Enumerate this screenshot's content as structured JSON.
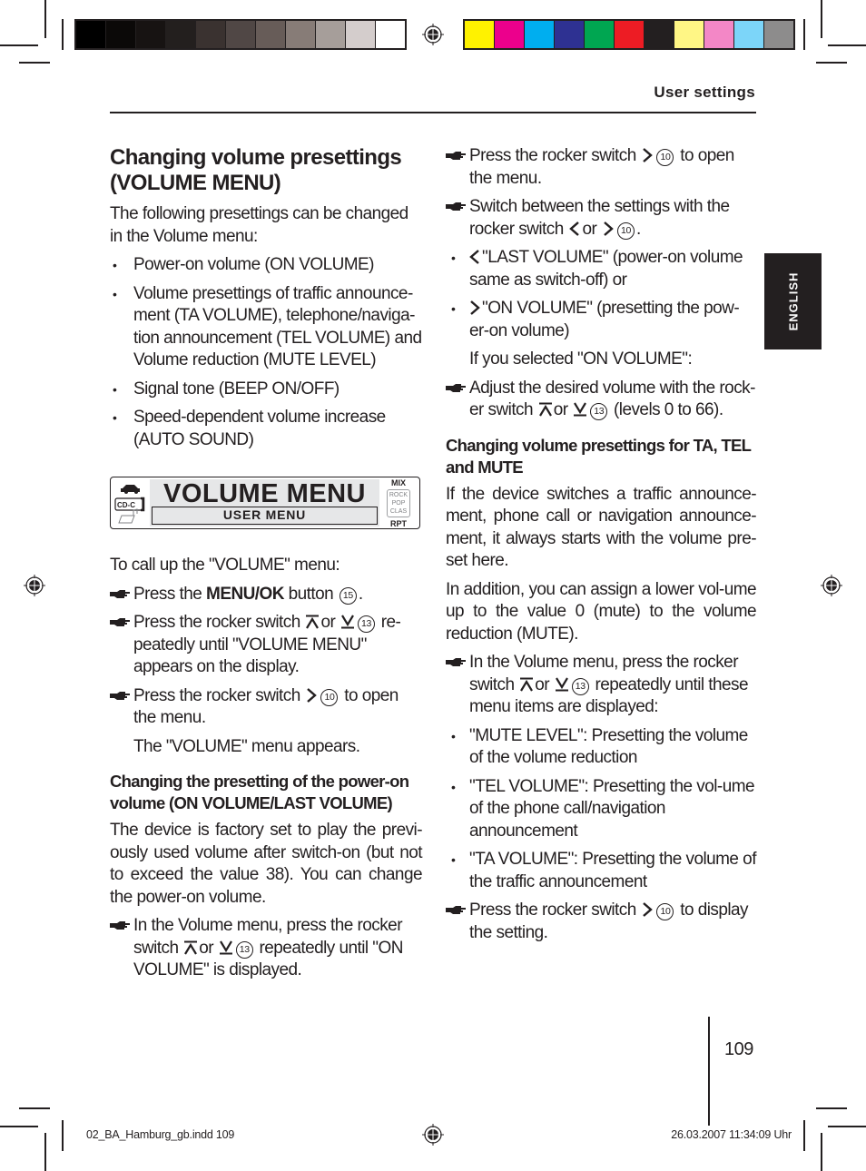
{
  "print_marks": {
    "grey_swatches": [
      "#000000",
      "#0b0908",
      "#171312",
      "#231f1e",
      "#3a3230",
      "#504745",
      "#675c58",
      "#877c77",
      "#a69e9a",
      "#d4cdcc",
      "#ffffff"
    ],
    "color_swatches": [
      "#fff200",
      "#ec008c",
      "#00aeef",
      "#2e3192",
      "#00a651",
      "#ed1c24",
      "#231f20",
      "#fff685",
      "#f387c6",
      "#7cd5f9",
      "#8d8c8c"
    ]
  },
  "header": {
    "section_title": "User settings"
  },
  "language_tab": "ENGLISH",
  "left_column": {
    "title": "Changing volume presettings (VOLUME MENU)",
    "intro": "The following presettings can be changed in the Volume menu:",
    "bullets": [
      "Power-on volume (ON VOLUME)",
      "Volume presettings of traffic announce-ment (TA VOLUME), telephone/naviga-tion announcement (TEL VOLUME) and Volume reduction (MUTE LEVEL)",
      "Signal tone (BEEP ON/OFF)",
      "Speed-dependent volume increase (AUTO SOUND)"
    ],
    "display": {
      "main_text": "VOLUME MENU",
      "sub_text": "USER MENU",
      "source_label": "CD-C",
      "mix_label": "MIX",
      "eq_options": [
        "ROCK",
        "POP",
        "CLAS"
      ],
      "rpt_label": "RPT"
    },
    "call_up_intro": "To call up the \"VOLUME\" menu:",
    "steps": [
      {
        "pre": "Press the ",
        "bold": "MENU/OK",
        "post": " button",
        "ref": "15",
        "tail": "."
      },
      {
        "pre": "Press the rocker switch",
        "sym1": "up",
        "mid": "or",
        "sym2": "down",
        "ref": "13",
        "post": "re-peatedly until \"VOLUME MENU\" appears on the display."
      },
      {
        "pre": "Press the rocker switch",
        "sym1": "right",
        "ref": "10",
        "post": "to open the menu."
      }
    ],
    "step_result": "The \"VOLUME\" menu appears.",
    "subheading": "Changing the presetting of the power-on volume (ON VOLUME/LAST VOLUME)",
    "paragraph": "The device is factory set to play the previ-ously used volume after switch-on (but not to exceed the value 38). You can change the power-on volume.",
    "final_step": {
      "pre": "In the Volume menu, press the rocker switch",
      "mid": "or",
      "ref": "13",
      "post": "repeatedly until \"ON VOLUME\" is displayed."
    }
  },
  "right_column": {
    "step1": {
      "pre": "Press the rocker switch",
      "ref": "10",
      "post": "to open the menu."
    },
    "step2": {
      "pre": "Switch between the settings with the rocker switch",
      "mid": "or",
      "ref": "10",
      "tail": "."
    },
    "options": [
      {
        "symbol": "left",
        "text": "\"LAST VOLUME\" (power-on volume same as switch-off) or"
      },
      {
        "symbol": "right",
        "text": "\"ON VOLUME\" (presetting the pow-er-on volume)"
      }
    ],
    "if_selected": "If you selected \"ON VOLUME\":",
    "step3": {
      "pre": "Adjust the desired volume with the rock-er switch",
      "mid": "or",
      "ref": "13",
      "post": "(levels 0 to 66)."
    },
    "subheading": "Changing volume presettings for TA, TEL and MUTE",
    "para1": "If the device switches a traffic announce-ment, phone call or navigation announce-ment, it always starts with the volume pre-set here.",
    "para2": "In addition, you can assign a lower vol-ume up to the value 0 (mute) to the volume reduction (MUTE).",
    "step4": {
      "pre": "In the Volume menu, press the rocker switch",
      "mid": "or",
      "ref": "13",
      "post": "repeatedly until these menu items are displayed:"
    },
    "menu_items": [
      "\"MUTE LEVEL\": Presetting the volume of the volume reduction",
      "\"TEL VOLUME\": Presetting the vol-ume of the phone call/navigation announcement",
      "\"TA VOLUME\": Presetting the volume of the traffic announcement"
    ],
    "step5": {
      "pre": "Press the rocker switch",
      "ref": "10",
      "post": "to display the setting."
    }
  },
  "footer": {
    "page_number": "109",
    "file_info": "02_BA_Hamburg_gb.indd   109",
    "timestamp": "26.03.2007   11:34:09 Uhr"
  }
}
